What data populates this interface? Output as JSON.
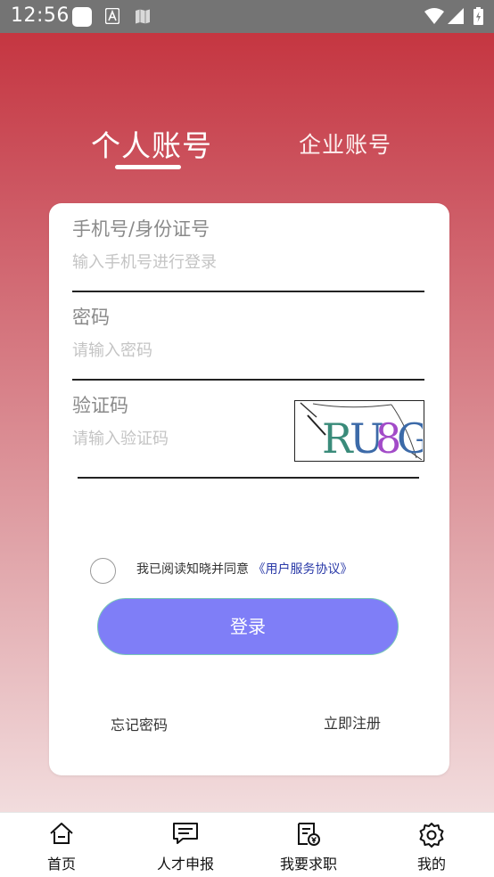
{
  "status_bar": {
    "time": "12:56"
  },
  "tabs": {
    "personal": "个人账号",
    "enterprise": "企业账号"
  },
  "form": {
    "phone": {
      "label": "手机号/身份证号",
      "placeholder": "输入手机号进行登录",
      "value": ""
    },
    "password": {
      "label": "密码",
      "placeholder": "请输入密码",
      "value": ""
    },
    "captcha": {
      "label": "验证码",
      "placeholder": "请输入验证码",
      "value": "",
      "image_text": "RU8G"
    }
  },
  "agreement": {
    "text": "我已阅读知晓并同意",
    "link": "《用户服务协议》"
  },
  "login_button": "登录",
  "links": {
    "forgot_password": "忘记密码",
    "register": "立即注册"
  },
  "bottom_nav": [
    {
      "label": "首页",
      "icon": "home-icon"
    },
    {
      "label": "人才申报",
      "icon": "message-icon"
    },
    {
      "label": "我要求职",
      "icon": "document-icon"
    },
    {
      "label": "我的",
      "icon": "gear-icon"
    }
  ],
  "colors": {
    "accent": "#c32f3a",
    "button": "#7f7ef7",
    "link": "#2a3aa8"
  }
}
